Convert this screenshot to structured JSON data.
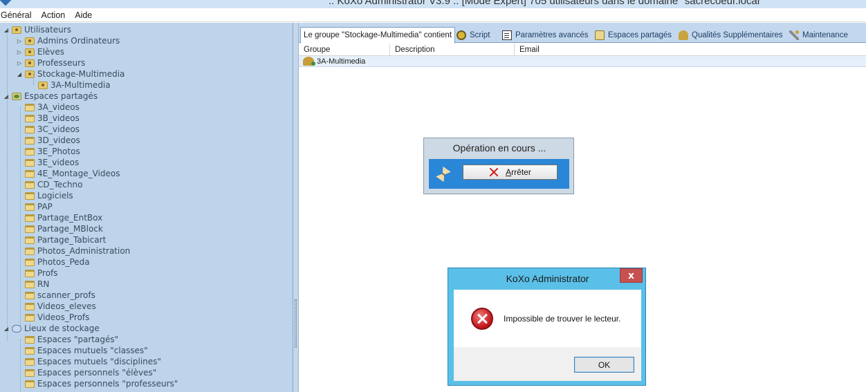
{
  "window": {
    "title": ".. KoXo Administrator V3.9 .. [Mode Expert] 705 utilisateurs dans le domaine \"sacrecoeur.local\""
  },
  "menu": {
    "items": [
      "Général",
      "Action",
      "Aide"
    ]
  },
  "tree": {
    "nodes": [
      {
        "label": "Utilisateurs",
        "level": 0,
        "toggle": "◢",
        "icon": "users-icon"
      },
      {
        "label": "Admins Ordinateurs",
        "level": 1,
        "toggle": "▷",
        "icon": "users-icon"
      },
      {
        "label": "Elèves",
        "level": 1,
        "toggle": "▷",
        "icon": "users-icon"
      },
      {
        "label": "Professeurs",
        "level": 1,
        "toggle": "▷",
        "icon": "users-icon"
      },
      {
        "label": "Stockage-Multimedia",
        "level": 1,
        "toggle": "◢",
        "icon": "users-icon"
      },
      {
        "label": "3A-Multimedia",
        "level": 2,
        "toggle": "",
        "icon": "users-icon"
      },
      {
        "label": "Espaces partagés",
        "level": 0,
        "toggle": "◢",
        "icon": "share-icon"
      },
      {
        "label": "3A_videos",
        "level": 1,
        "toggle": "",
        "icon": "folder-icon"
      },
      {
        "label": "3B_videos",
        "level": 1,
        "toggle": "",
        "icon": "folder-icon"
      },
      {
        "label": "3C_videos",
        "level": 1,
        "toggle": "",
        "icon": "folder-icon"
      },
      {
        "label": "3D_videos",
        "level": 1,
        "toggle": "",
        "icon": "folder-icon"
      },
      {
        "label": "3E_Photos",
        "level": 1,
        "toggle": "",
        "icon": "folder-icon"
      },
      {
        "label": "3E_videos",
        "level": 1,
        "toggle": "",
        "icon": "folder-icon"
      },
      {
        "label": "4E_Montage_Videos",
        "level": 1,
        "toggle": "",
        "icon": "folder-icon"
      },
      {
        "label": "CD_Techno",
        "level": 1,
        "toggle": "",
        "icon": "folder-icon"
      },
      {
        "label": "Logiciels",
        "level": 1,
        "toggle": "",
        "icon": "folder-icon"
      },
      {
        "label": "PAP",
        "level": 1,
        "toggle": "",
        "icon": "folder-icon"
      },
      {
        "label": "Partage_EntBox",
        "level": 1,
        "toggle": "",
        "icon": "folder-icon"
      },
      {
        "label": "Partage_MBlock",
        "level": 1,
        "toggle": "",
        "icon": "folder-icon"
      },
      {
        "label": "Partage_Tabicart",
        "level": 1,
        "toggle": "",
        "icon": "folder-icon"
      },
      {
        "label": "Photos_Administration",
        "level": 1,
        "toggle": "",
        "icon": "folder-icon"
      },
      {
        "label": "Photos_Peda",
        "level": 1,
        "toggle": "",
        "icon": "folder-icon"
      },
      {
        "label": "Profs",
        "level": 1,
        "toggle": "",
        "icon": "folder-icon"
      },
      {
        "label": "RN",
        "level": 1,
        "toggle": "",
        "icon": "folder-icon"
      },
      {
        "label": "scanner_profs",
        "level": 1,
        "toggle": "",
        "icon": "folder-icon"
      },
      {
        "label": "Videos_eleves",
        "level": 1,
        "toggle": "",
        "icon": "folder-icon"
      },
      {
        "label": "Videos_Profs",
        "level": 1,
        "toggle": "",
        "icon": "folder-icon"
      },
      {
        "label": "Lieux de stockage",
        "level": 0,
        "toggle": "◢",
        "icon": "storage-icon"
      },
      {
        "label": "Espaces \"partagés\"",
        "level": 1,
        "toggle": "",
        "icon": "folder-icon"
      },
      {
        "label": "Espaces mutuels \"classes\"",
        "level": 1,
        "toggle": "",
        "icon": "folder-icon"
      },
      {
        "label": "Espaces mutuels \"disciplines\"",
        "level": 1,
        "toggle": "",
        "icon": "folder-icon"
      },
      {
        "label": "Espaces personnels \"élèves\"",
        "level": 1,
        "toggle": "",
        "icon": "folder-icon"
      },
      {
        "label": "Espaces personnels \"professeurs\"",
        "level": 1,
        "toggle": "",
        "icon": "folder-icon"
      }
    ]
  },
  "tabs": [
    {
      "label": "Le groupe \"Stockage-Multimedia\" contient",
      "icon": "",
      "active": true
    },
    {
      "label": "Script",
      "icon": "gear-icon",
      "active": false
    },
    {
      "label": "Paramètres avancés",
      "icon": "document-icon",
      "active": false
    },
    {
      "label": "Espaces partagés",
      "icon": "shares-icon",
      "active": false
    },
    {
      "label": "Qualités Supplémentaires",
      "icon": "users-icon",
      "active": false
    },
    {
      "label": "Maintenance",
      "icon": "tools-icon",
      "active": false
    }
  ],
  "list": {
    "columns": [
      "Groupe",
      "Description",
      "Email"
    ],
    "rows": [
      {
        "groupe": "3A-Multimedia",
        "description": "",
        "email": ""
      }
    ]
  },
  "operation_dialog": {
    "title": "Opération en cours ...",
    "stop_mnemonic": "A",
    "stop_rest": "rrêter"
  },
  "message_box": {
    "title": "KoXo Administrator",
    "close_label": "x",
    "message": "Impossible de trouver le lecteur.",
    "ok_label": "OK"
  },
  "colors": {
    "tree_background": "#bdd4ea",
    "tab_bar": "#c3d8ee",
    "operation_body": "#2a86d6",
    "message_box_frame": "#5bc0e8",
    "close_button": "#c75050",
    "error_red": "#c0141a"
  }
}
